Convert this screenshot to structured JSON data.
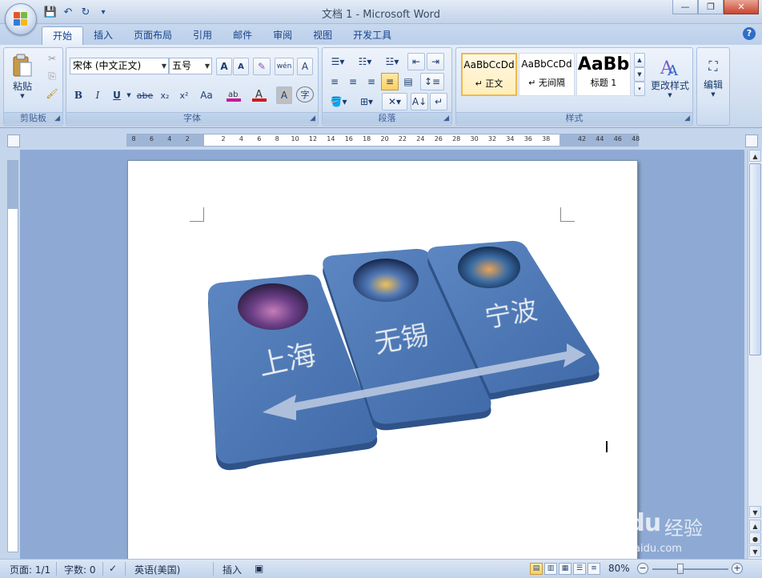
{
  "window": {
    "title": "文档 1 - Microsoft Word",
    "minimize": "—",
    "restore": "❐",
    "close": "✕"
  },
  "qat": {
    "save": "💾",
    "undo": "↶",
    "redo": "↻",
    "more": "▾"
  },
  "tabs": [
    {
      "label": "开始",
      "active": true
    },
    {
      "label": "插入"
    },
    {
      "label": "页面布局"
    },
    {
      "label": "引用"
    },
    {
      "label": "邮件"
    },
    {
      "label": "审阅"
    },
    {
      "label": "视图"
    },
    {
      "label": "开发工具"
    }
  ],
  "help": "?",
  "ribbon": {
    "clipboard": {
      "label": "剪贴板",
      "paste": "粘贴"
    },
    "font": {
      "label": "字体",
      "font_name": "宋体 (中文正文)",
      "font_size": "五号",
      "bold": "B",
      "italic": "I",
      "underline": "U",
      "strike": "abe",
      "subscript": "x₂",
      "superscript": "x²",
      "change_case": "Aa",
      "grow": "A",
      "shrink": "A",
      "phonetic": "wén",
      "char_border": "A",
      "char_shading": "A",
      "enclose": "字"
    },
    "paragraph": {
      "label": "段落"
    },
    "styles": {
      "label": "样式",
      "items": [
        {
          "sample": "AaBbCcDd",
          "name": "↵ 正文",
          "selected": true
        },
        {
          "sample": "AaBbCcDd",
          "name": "↵ 无间隔"
        },
        {
          "sample": "AaBb",
          "name": "标题 1"
        }
      ],
      "change_styles": "更改样式"
    },
    "editing": {
      "label": "编辑"
    }
  },
  "ruler": {
    "ticks": [
      "8",
      "6",
      "4",
      "2",
      "2",
      "4",
      "6",
      "8",
      "10",
      "12",
      "14",
      "16",
      "18",
      "20",
      "22",
      "24",
      "26",
      "28",
      "30",
      "32",
      "34",
      "36",
      "38",
      "42",
      "44",
      "46",
      "48"
    ]
  },
  "smartart": {
    "cards": [
      {
        "label": "上海"
      },
      {
        "label": "无锡"
      },
      {
        "label": "宁波"
      }
    ]
  },
  "status": {
    "page": "页面: 1/1",
    "words": "字数: 0",
    "language": "英语(美国)",
    "mode": "插入",
    "zoom": "80%",
    "zoom_out": "−",
    "zoom_in": "+"
  },
  "watermark": {
    "logo": "Baidu",
    "experience": "经验",
    "url": "jingyan.baidu.com"
  }
}
